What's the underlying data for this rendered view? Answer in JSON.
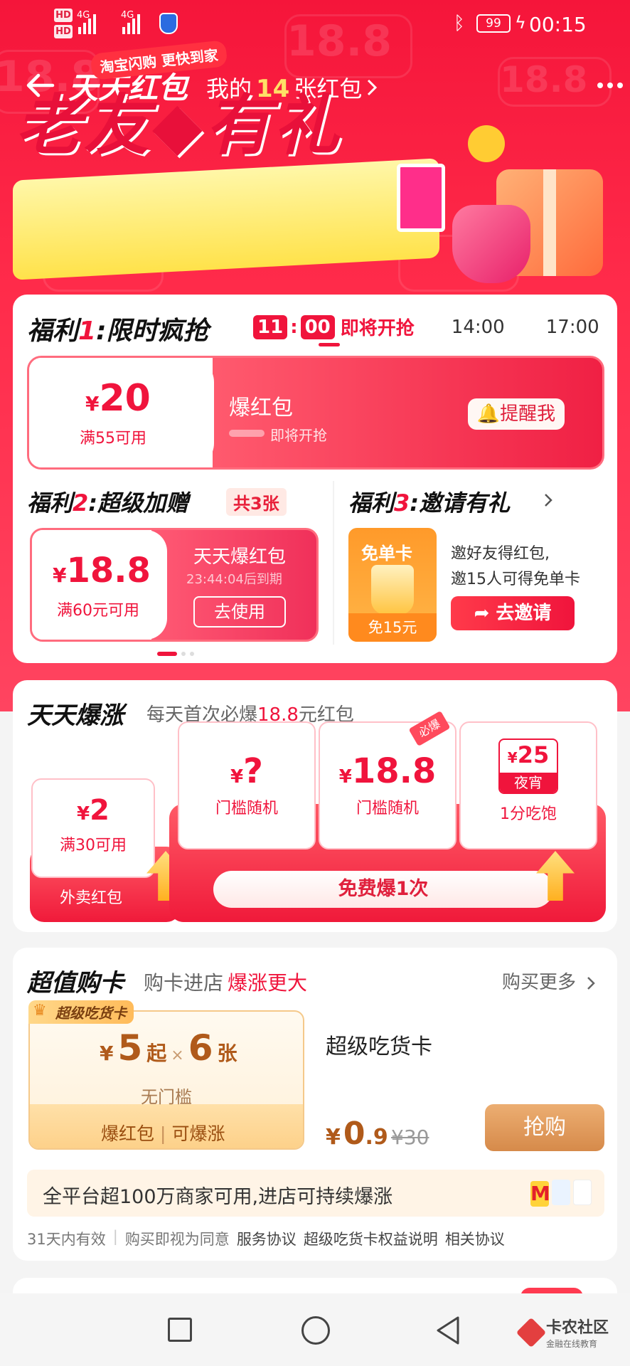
{
  "status": {
    "hd1": "HD",
    "hd2": "HD",
    "net1": "4G",
    "net2": "4G",
    "battery": "99",
    "time": "00:15"
  },
  "header": {
    "title": "天天红包",
    "mine_prefix": "我的",
    "mine_count": "14",
    "mine_suffix": "张红包"
  },
  "banner": {
    "tag": "淘宝闪购 更快到家",
    "headline": "老友◆有礼"
  },
  "welfare1": {
    "title_a": "福利",
    "title_n": "1",
    "title_b": ":限时疯抢",
    "tab_active_h": "11",
    "tab_active_m": "00",
    "tab_active_label": "即将开抢",
    "tab2": "14:00",
    "tab3": "17:00",
    "coupon": {
      "currency": "¥",
      "amount": "20",
      "condition": "满55可用",
      "name": "爆红包",
      "status": "即将开抢",
      "button": "提醒我"
    }
  },
  "welfare2": {
    "title_a": "福利",
    "title_n": "2",
    "title_b": ":超级加赠",
    "count_tag": "共3张",
    "coupon": {
      "currency": "¥",
      "amount": "18.8",
      "condition": "满60元可用",
      "name": "天天爆红包",
      "expiry": "23:44:04后到期",
      "button": "去使用"
    }
  },
  "welfare3": {
    "title_a": "福利",
    "title_n": "3",
    "title_b": ":邀请有礼",
    "card_title": "免单卡",
    "card_bottom": "免15元",
    "desc1": "邀好友得红包,",
    "desc2": "邀15人可得免单卡",
    "button": "去邀请"
  },
  "daily": {
    "title": "天天爆涨",
    "subtitle_a": "每天首次必爆",
    "subtitle_amount": "18.8",
    "subtitle_b": "元红包",
    "item1": {
      "currency": "¥",
      "amount": "2",
      "cond": "满30可用",
      "label": "外卖红包"
    },
    "item2": {
      "currency": "¥",
      "amount": "?",
      "cond": "门槛随机"
    },
    "item3": {
      "currency": "¥",
      "amount": "18.8",
      "cond": "门槛随机",
      "badge": "必爆"
    },
    "item4": {
      "currency": "¥",
      "amount": "25",
      "tag": "夜宵",
      "cond": "1分吃饱"
    },
    "button": "免费爆1次"
  },
  "card": {
    "title": "超值购卡",
    "subtitle_a": "购卡进店",
    "subtitle_b": "爆涨更大",
    "more": "购买更多",
    "badge": "超级吃货卡",
    "currency": "¥",
    "amount": "5",
    "qi": "起",
    "times": "×",
    "count": "6",
    "zhang": "张",
    "nothreshold": "无门槛",
    "feat1": "爆红包",
    "feat2": "可爆涨",
    "name": "超级吃货卡",
    "price_cur": "¥",
    "price_int": "0",
    "price_dec": ".9",
    "orig": "¥30",
    "buy": "抢购",
    "info": "全平台超100万商家可用,进店可持续爆涨",
    "terms": [
      "31天内有效",
      "购买即视为同意",
      "服务协议",
      "超级吃货卡权益说明",
      "相关协议"
    ]
  },
  "watermark": {
    "main": "卡农社区",
    "sub": "金融在线教育"
  },
  "colors": {
    "primary": "#f0143c",
    "accent_yellow": "#ffe066",
    "gold": "#d68a4a"
  }
}
